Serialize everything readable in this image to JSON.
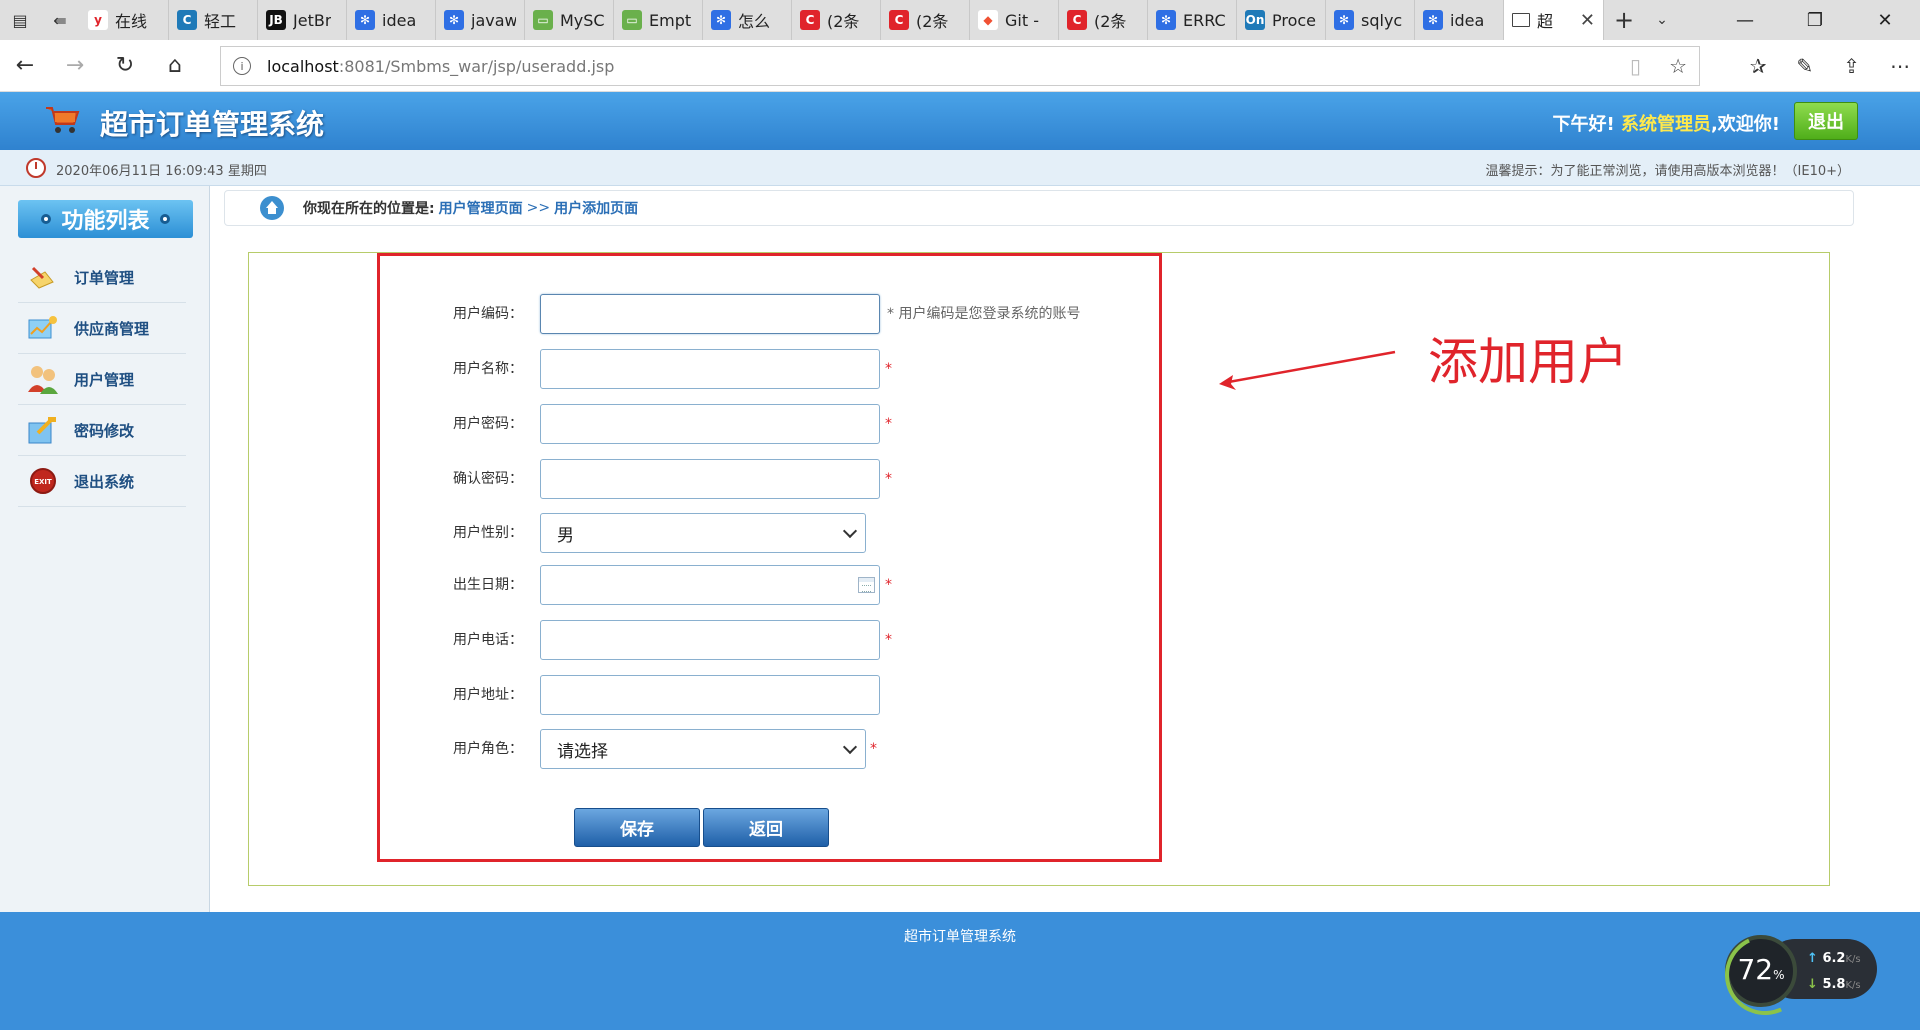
{
  "browser": {
    "tabs": [
      {
        "icon": "yandex-icon",
        "label": "在线",
        "fav_text": "y",
        "fav_color": "#ffffff",
        "fav_fg": "#e0242b"
      },
      {
        "icon": "c-logo-icon",
        "label": "轻工",
        "fav_text": "C",
        "fav_color": "#1f7ab8",
        "fav_fg": "#ffffff"
      },
      {
        "icon": "jetbrains-icon",
        "label": "JetBr",
        "fav_text": "JB",
        "fav_color": "#111111",
        "fav_fg": "#ffffff"
      },
      {
        "icon": "baidu-paw-icon",
        "label": "idea",
        "fav_text": "✻",
        "fav_color": "#2f6fe4",
        "fav_fg": "#ffffff"
      },
      {
        "icon": "baidu-paw-icon",
        "label": "javaw",
        "fav_text": "✻",
        "fav_color": "#2f6fe4",
        "fav_fg": "#ffffff"
      },
      {
        "icon": "green-box-icon",
        "label": "MySC",
        "fav_text": "▭",
        "fav_color": "#6ab04c",
        "fav_fg": "#ffffff"
      },
      {
        "icon": "green-box-icon",
        "label": "Empt",
        "fav_text": "▭",
        "fav_color": "#6ab04c",
        "fav_fg": "#ffffff"
      },
      {
        "icon": "baidu-paw-icon",
        "label": "怎么",
        "fav_text": "✻",
        "fav_color": "#2f6fe4",
        "fav_fg": "#ffffff"
      },
      {
        "icon": "csdn-icon",
        "label": "(2条",
        "fav_text": "C",
        "fav_color": "#e0242b",
        "fav_fg": "#ffffff"
      },
      {
        "icon": "csdn-icon",
        "label": "(2条",
        "fav_text": "C",
        "fav_color": "#e0242b",
        "fav_fg": "#ffffff"
      },
      {
        "icon": "git-icon",
        "label": "Git -",
        "fav_text": "◆",
        "fav_color": "#ffffff",
        "fav_fg": "#f05133"
      },
      {
        "icon": "csdn-icon",
        "label": "(2条",
        "fav_text": "C",
        "fav_color": "#e0242b",
        "fav_fg": "#ffffff"
      },
      {
        "icon": "baidu-paw-icon",
        "label": "ERRC",
        "fav_text": "✻",
        "fav_color": "#2f6fe4",
        "fav_fg": "#ffffff"
      },
      {
        "icon": "onenote-icon",
        "label": "Proce",
        "fav_text": "On",
        "fav_color": "#1f7ab8",
        "fav_fg": "#ffffff"
      },
      {
        "icon": "baidu-paw-icon",
        "label": "sqlyc",
        "fav_text": "✻",
        "fav_color": "#2f6fe4",
        "fav_fg": "#ffffff"
      },
      {
        "icon": "baidu-paw-icon",
        "label": "idea",
        "fav_text": "✻",
        "fav_color": "#2f6fe4",
        "fav_fg": "#ffffff"
      }
    ],
    "active_tab": {
      "label": "超",
      "icon": "page-icon"
    },
    "url_host": "localhost",
    "url_rest": ":8081/Smbms_war/jsp/useradd.jsp"
  },
  "app": {
    "title": "超市订单管理系统",
    "greeting_prefix": "下午好!",
    "user_name": "系统管理员",
    "greeting_suffix": ",欢迎你!",
    "logout_label": "退出",
    "datetime": "2020年06月11日 16:09:43 星期四",
    "tip": "温馨提示：为了能正常浏览，请使用高版本浏览器！（IE10+）"
  },
  "sidebar": {
    "title": "功能列表",
    "items": [
      {
        "label": "订单管理",
        "icon": "order-icon"
      },
      {
        "label": "供应商管理",
        "icon": "supplier-icon"
      },
      {
        "label": "用户管理",
        "icon": "users-icon"
      },
      {
        "label": "密码修改",
        "icon": "password-icon"
      },
      {
        "label": "退出系统",
        "icon": "exit-icon"
      }
    ]
  },
  "breadcrumb": {
    "label": "你现在所在的位置是:",
    "path1": "用户管理页面",
    "sep": ">>",
    "path2": "用户添加页面"
  },
  "form": {
    "usercode_label": "用户编码：",
    "usercode_hint": "* 用户编码是您登录系统的账号",
    "username_label": "用户名称：",
    "password_label": "用户密码：",
    "repassword_label": "确认密码：",
    "gender_label": "用户性别：",
    "gender_value": "男",
    "birthday_label": "出生日期：",
    "phone_label": "用户电话：",
    "address_label": "用户地址：",
    "role_label": "用户角色：",
    "role_value": "请选择",
    "required_mark": "*",
    "save_label": "保存",
    "back_label": "返回"
  },
  "annotation": {
    "text": "添加用户",
    "color": "#e0242b"
  },
  "footer": {
    "text": "超市订单管理系统"
  },
  "net_monitor": {
    "percent": "72",
    "percent_unit": "%",
    "up_speed": "6.2",
    "down_speed": "5.8",
    "speed_unit": "K/s"
  }
}
